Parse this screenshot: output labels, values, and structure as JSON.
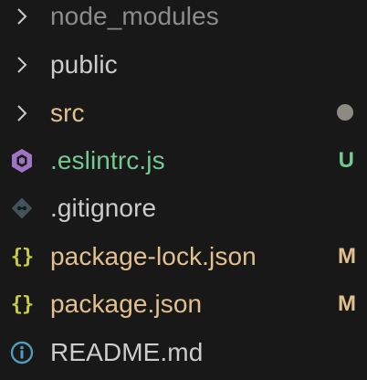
{
  "colors": {
    "background": "#181818",
    "default_text": "#cccccc",
    "ignored_text": "#8c8c8c",
    "untracked": "#73c991",
    "modified": "#e2c08d",
    "folder_dot": "#8e8a82",
    "chevron": "#cccccc",
    "eslint_icon": "#a074c4",
    "git_icon": "#41535b",
    "json_icon": "#cbcb41",
    "info_icon": "#519aba"
  },
  "tree": {
    "items": [
      {
        "label": "node_modules",
        "kind": "folder",
        "icon": "chevron-right-icon"
      },
      {
        "label": "public",
        "kind": "folder",
        "icon": "chevron-right-icon"
      },
      {
        "label": "src",
        "kind": "folder",
        "icon": "chevron-right-icon",
        "decoration": "modified-dot"
      },
      {
        "label": ".eslintrc.js",
        "kind": "file",
        "icon": "eslint-icon",
        "badge": "U"
      },
      {
        "label": ".gitignore",
        "kind": "file",
        "icon": "git-icon"
      },
      {
        "label": "package-lock.json",
        "kind": "file",
        "icon": "json-braces-icon",
        "icon_text": "{}",
        "badge": "M"
      },
      {
        "label": "package.json",
        "kind": "file",
        "icon": "json-braces-icon",
        "icon_text": "{}",
        "badge": "M"
      },
      {
        "label": "README.md",
        "kind": "file",
        "icon": "info-icon"
      }
    ]
  }
}
